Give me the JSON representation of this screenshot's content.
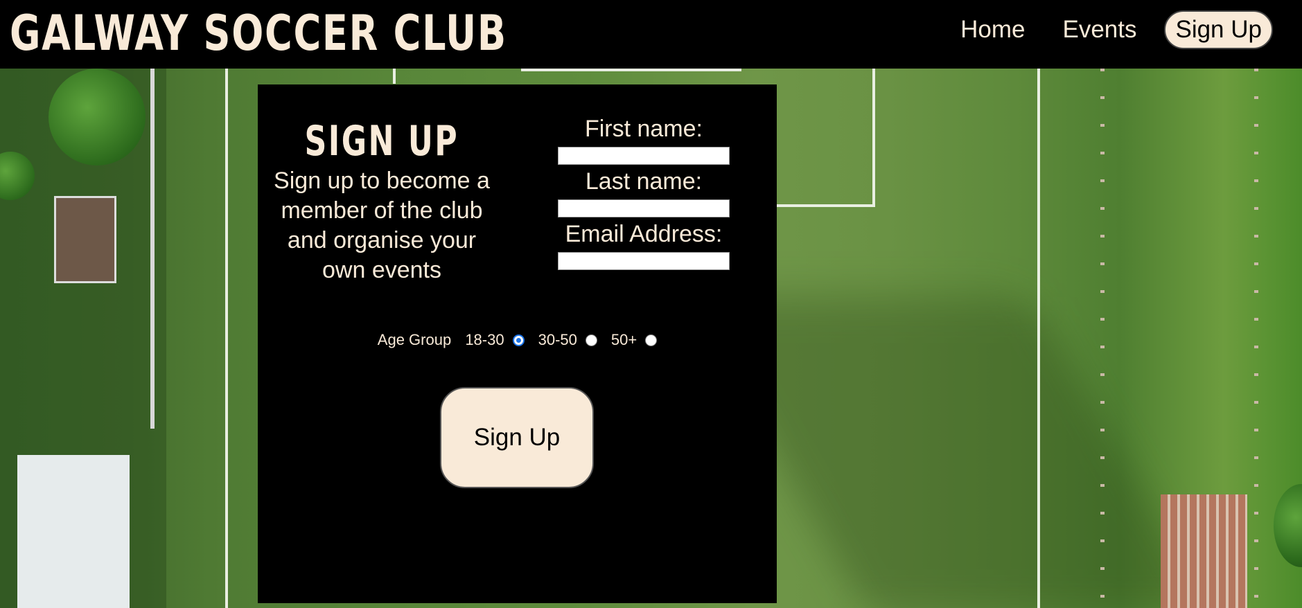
{
  "header": {
    "logo": "GALWAY SOCCER CLUB",
    "nav": [
      {
        "label": "Home",
        "active": false
      },
      {
        "label": "Events",
        "active": false
      },
      {
        "label": "Sign Up",
        "active": true
      }
    ]
  },
  "signup": {
    "title": "SIGN UP",
    "description": "Sign up to become a member of the club and organise your own events",
    "fields": [
      {
        "label": "First name:",
        "value": ""
      },
      {
        "label": "Last name:",
        "value": ""
      },
      {
        "label": "Email Address:",
        "value": ""
      }
    ],
    "age_group": {
      "label": "Age Group",
      "options": [
        "18-30",
        "30-50",
        "50+"
      ],
      "selected": "18-30"
    },
    "submit_label": "Sign Up"
  },
  "colors": {
    "accent": "#f9ead8",
    "header_bg": "#000000",
    "panel_bg": "#000000",
    "radio_selected": "#1a73e8"
  },
  "icons": {
    "background": "soccer-field-aerial-photo"
  }
}
